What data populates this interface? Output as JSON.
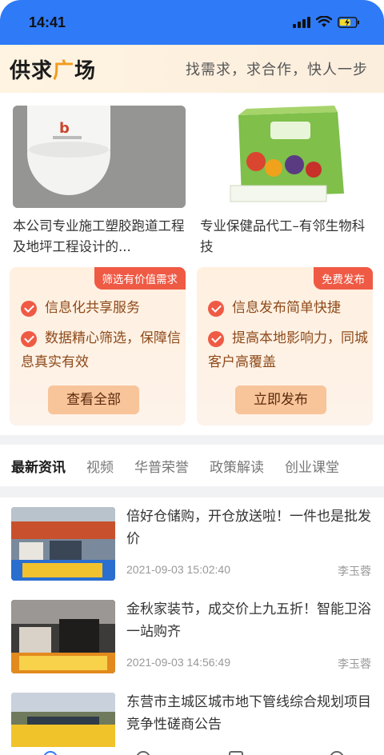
{
  "status": {
    "time": "14:41"
  },
  "banner": {
    "logo_left": "供求",
    "logo_accent": "广",
    "logo_right": "场",
    "slogan": "找需求，求合作，快人一步"
  },
  "products": [
    {
      "title": "本公司专业施工塑胶跑道工程及地坪工程设计的...",
      "image": "white-helmet-photo"
    },
    {
      "title": "专业保健品代工–有邻生物科技",
      "image": "health-product-box-photo"
    }
  ],
  "promos": [
    {
      "tag": "筛选有价值需求",
      "features": [
        "信息化共享服务",
        "数据精心筛选，保障信息真实有效"
      ],
      "button": "查看全部"
    },
    {
      "tag": "免费发布",
      "features": [
        "信息发布简单快捷",
        "提高本地影响力，同城客户高覆盖"
      ],
      "button": "立即发布"
    }
  ],
  "tabs": [
    "最新资讯",
    "视频",
    "华普荣誉",
    "政策解读",
    "创业课堂"
  ],
  "news": [
    {
      "title": "倍好仓储购，开仓放送啦！一件也是批发价",
      "date": "2021-09-03 15:02:40",
      "author": "李玉蓉",
      "image": "storefront-photo"
    },
    {
      "title": "金秋家装节，成交价上九五折！智能卫浴一站购齐",
      "date": "2021-09-03 14:56:49",
      "author": "李玉蓉",
      "image": "bathroom-showroom-photo"
    },
    {
      "title": "东营市主城区城市地下管线综合规划项目竞争性磋商公告",
      "date": "",
      "author": "",
      "image": "pipeline-construction-photo"
    }
  ],
  "colors": {
    "accent": "#f39a1c",
    "tag_red": "#ef5a45",
    "status_blue": "#2f7af7"
  }
}
